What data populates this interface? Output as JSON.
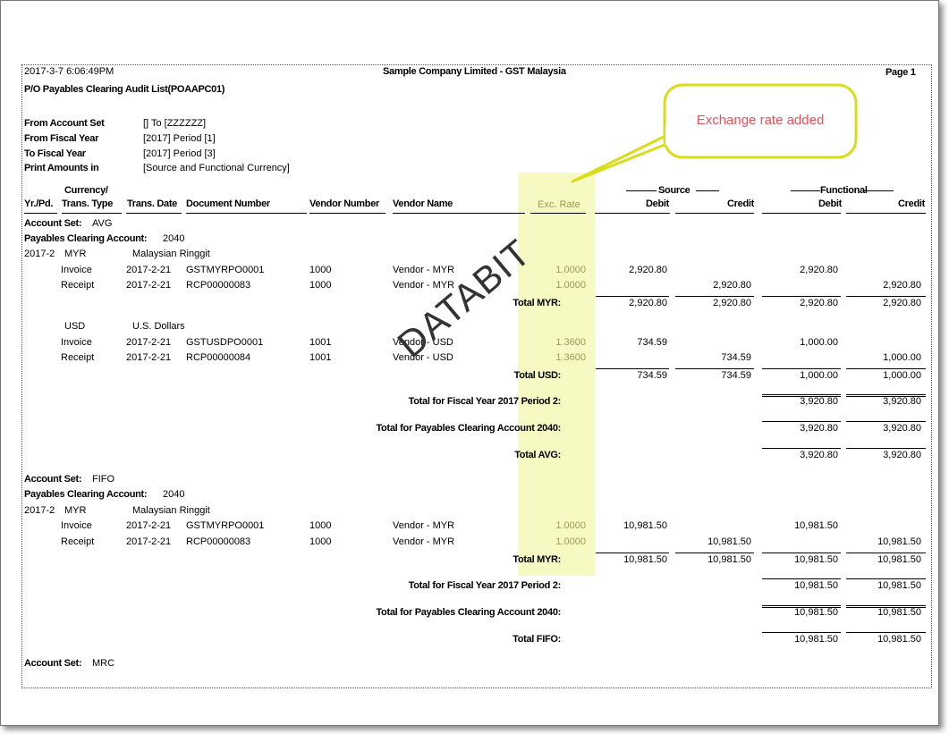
{
  "header": {
    "datetime": "2017-3-7  6:06:49PM",
    "company": "Sample Company Limited - GST Malaysia",
    "page": "Page 1",
    "title": "P/O Payables Clearing Audit List(POAAPC01)"
  },
  "params": [
    {
      "label": "From Account Set",
      "value": "[]  To  [ZZZZZZ]"
    },
    {
      "label": "From Fiscal Year",
      "value": "[2017]  Period  [1]"
    },
    {
      "label": "To Fiscal Year",
      "value": "[2017]  Period  [3]"
    },
    {
      "label": "Print Amounts in",
      "value": "[Source and Functional Currency]"
    }
  ],
  "columns": {
    "currency": "Currency/",
    "yrpd": "Yr./Pd.",
    "type": "Trans. Type",
    "date": "Trans. Date",
    "doc": "Document Number",
    "vnum": "Vendor Number",
    "vname": "Vendor Name",
    "rate": "Exc. Rate",
    "source": "Source",
    "functional": "Functional",
    "debit": "Debit",
    "credit": "Credit"
  },
  "callout": {
    "text": "Exchange rate added",
    "border_color": "#d8dc1a",
    "text_color": "#e8505a",
    "highlight_color": "#f6fac2"
  },
  "watermark": "DATABIT",
  "rows": [
    {
      "kind": "set",
      "label": "Account Set:",
      "value": "AVG"
    },
    {
      "kind": "set",
      "label": "Payables Clearing Account:",
      "value": "2040"
    },
    {
      "kind": "cur",
      "yrpd": "2017-2",
      "code": "MYR",
      "name": "Malaysian Ringgit"
    },
    {
      "kind": "det",
      "type": "Invoice",
      "date": "2017-2-21",
      "doc": "GSTMYRPO0001",
      "vnum": "1000",
      "vname": "Vendor - MYR",
      "rate": "1.0000",
      "sd": "2,920.80",
      "sc": "",
      "fd": "2,920.80",
      "fc": ""
    },
    {
      "kind": "det",
      "type": "Receipt",
      "date": "2017-2-21",
      "doc": "RCP00000083",
      "vnum": "1000",
      "vname": "Vendor - MYR",
      "rate": "1.0000",
      "sd": "",
      "sc": "2,920.80",
      "fd": "",
      "fc": "2,920.80"
    },
    {
      "kind": "tot",
      "label": "Total MYR:",
      "sd": "2,920.80",
      "sc": "2,920.80",
      "fd": "2,920.80",
      "fc": "2,920.80"
    },
    {
      "kind": "cur",
      "yrpd": "",
      "code": "USD",
      "name": "U.S. Dollars"
    },
    {
      "kind": "det",
      "type": "Invoice",
      "date": "2017-2-21",
      "doc": "GSTUSDPO0001",
      "vnum": "1001",
      "vname": "Vendor - USD",
      "rate": "1.3600",
      "sd": "734.59",
      "sc": "",
      "fd": "1,000.00",
      "fc": ""
    },
    {
      "kind": "det",
      "type": "Receipt",
      "date": "2017-2-21",
      "doc": "RCP00000084",
      "vnum": "1001",
      "vname": "Vendor - USD",
      "rate": "1.3600",
      "sd": "",
      "sc": "734.59",
      "fd": "",
      "fc": "1,000.00"
    },
    {
      "kind": "tot",
      "label": "Total USD:",
      "sd": "734.59",
      "sc": "734.59",
      "fd": "1,000.00",
      "fc": "1,000.00"
    },
    {
      "kind": "ftot",
      "label": "Total for Fiscal Year 2017 Period 2:",
      "fd": "3,920.80",
      "fc": "3,920.80"
    },
    {
      "kind": "ftot",
      "label": "Total for Payables Clearing Account 2040:",
      "fd": "3,920.80",
      "fc": "3,920.80"
    },
    {
      "kind": "ftot",
      "label": "Total AVG:",
      "fd": "3,920.80",
      "fc": "3,920.80"
    },
    {
      "kind": "set",
      "label": "Account Set:",
      "value": "FIFO"
    },
    {
      "kind": "set",
      "label": "Payables Clearing Account:",
      "value": "2040"
    },
    {
      "kind": "cur",
      "yrpd": "2017-2",
      "code": "MYR",
      "name": "Malaysian Ringgit"
    },
    {
      "kind": "det",
      "type": "Invoice",
      "date": "2017-2-21",
      "doc": "GSTMYRPO0001",
      "vnum": "1000",
      "vname": "Vendor - MYR",
      "rate": "1.0000",
      "sd": "10,981.50",
      "sc": "",
      "fd": "10,981.50",
      "fc": ""
    },
    {
      "kind": "det",
      "type": "Receipt",
      "date": "2017-2-21",
      "doc": "RCP00000083",
      "vnum": "1000",
      "vname": "Vendor - MYR",
      "rate": "1.0000",
      "sd": "",
      "sc": "10,981.50",
      "fd": "",
      "fc": "10,981.50"
    },
    {
      "kind": "tot",
      "label": "Total MYR:",
      "sd": "10,981.50",
      "sc": "10,981.50",
      "fd": "10,981.50",
      "fc": "10,981.50"
    },
    {
      "kind": "ftot",
      "label": "Total for Fiscal Year 2017 Period 2:",
      "fd": "10,981.50",
      "fc": "10,981.50"
    },
    {
      "kind": "ftot",
      "label": "Total for Payables Clearing Account 2040:",
      "fd": "10,981.50",
      "fc": "10,981.50"
    },
    {
      "kind": "ftot",
      "label": "Total FIFO:",
      "fd": "10,981.50",
      "fc": "10,981.50"
    },
    {
      "kind": "set",
      "label": "Account Set:",
      "value": "MRC"
    }
  ]
}
